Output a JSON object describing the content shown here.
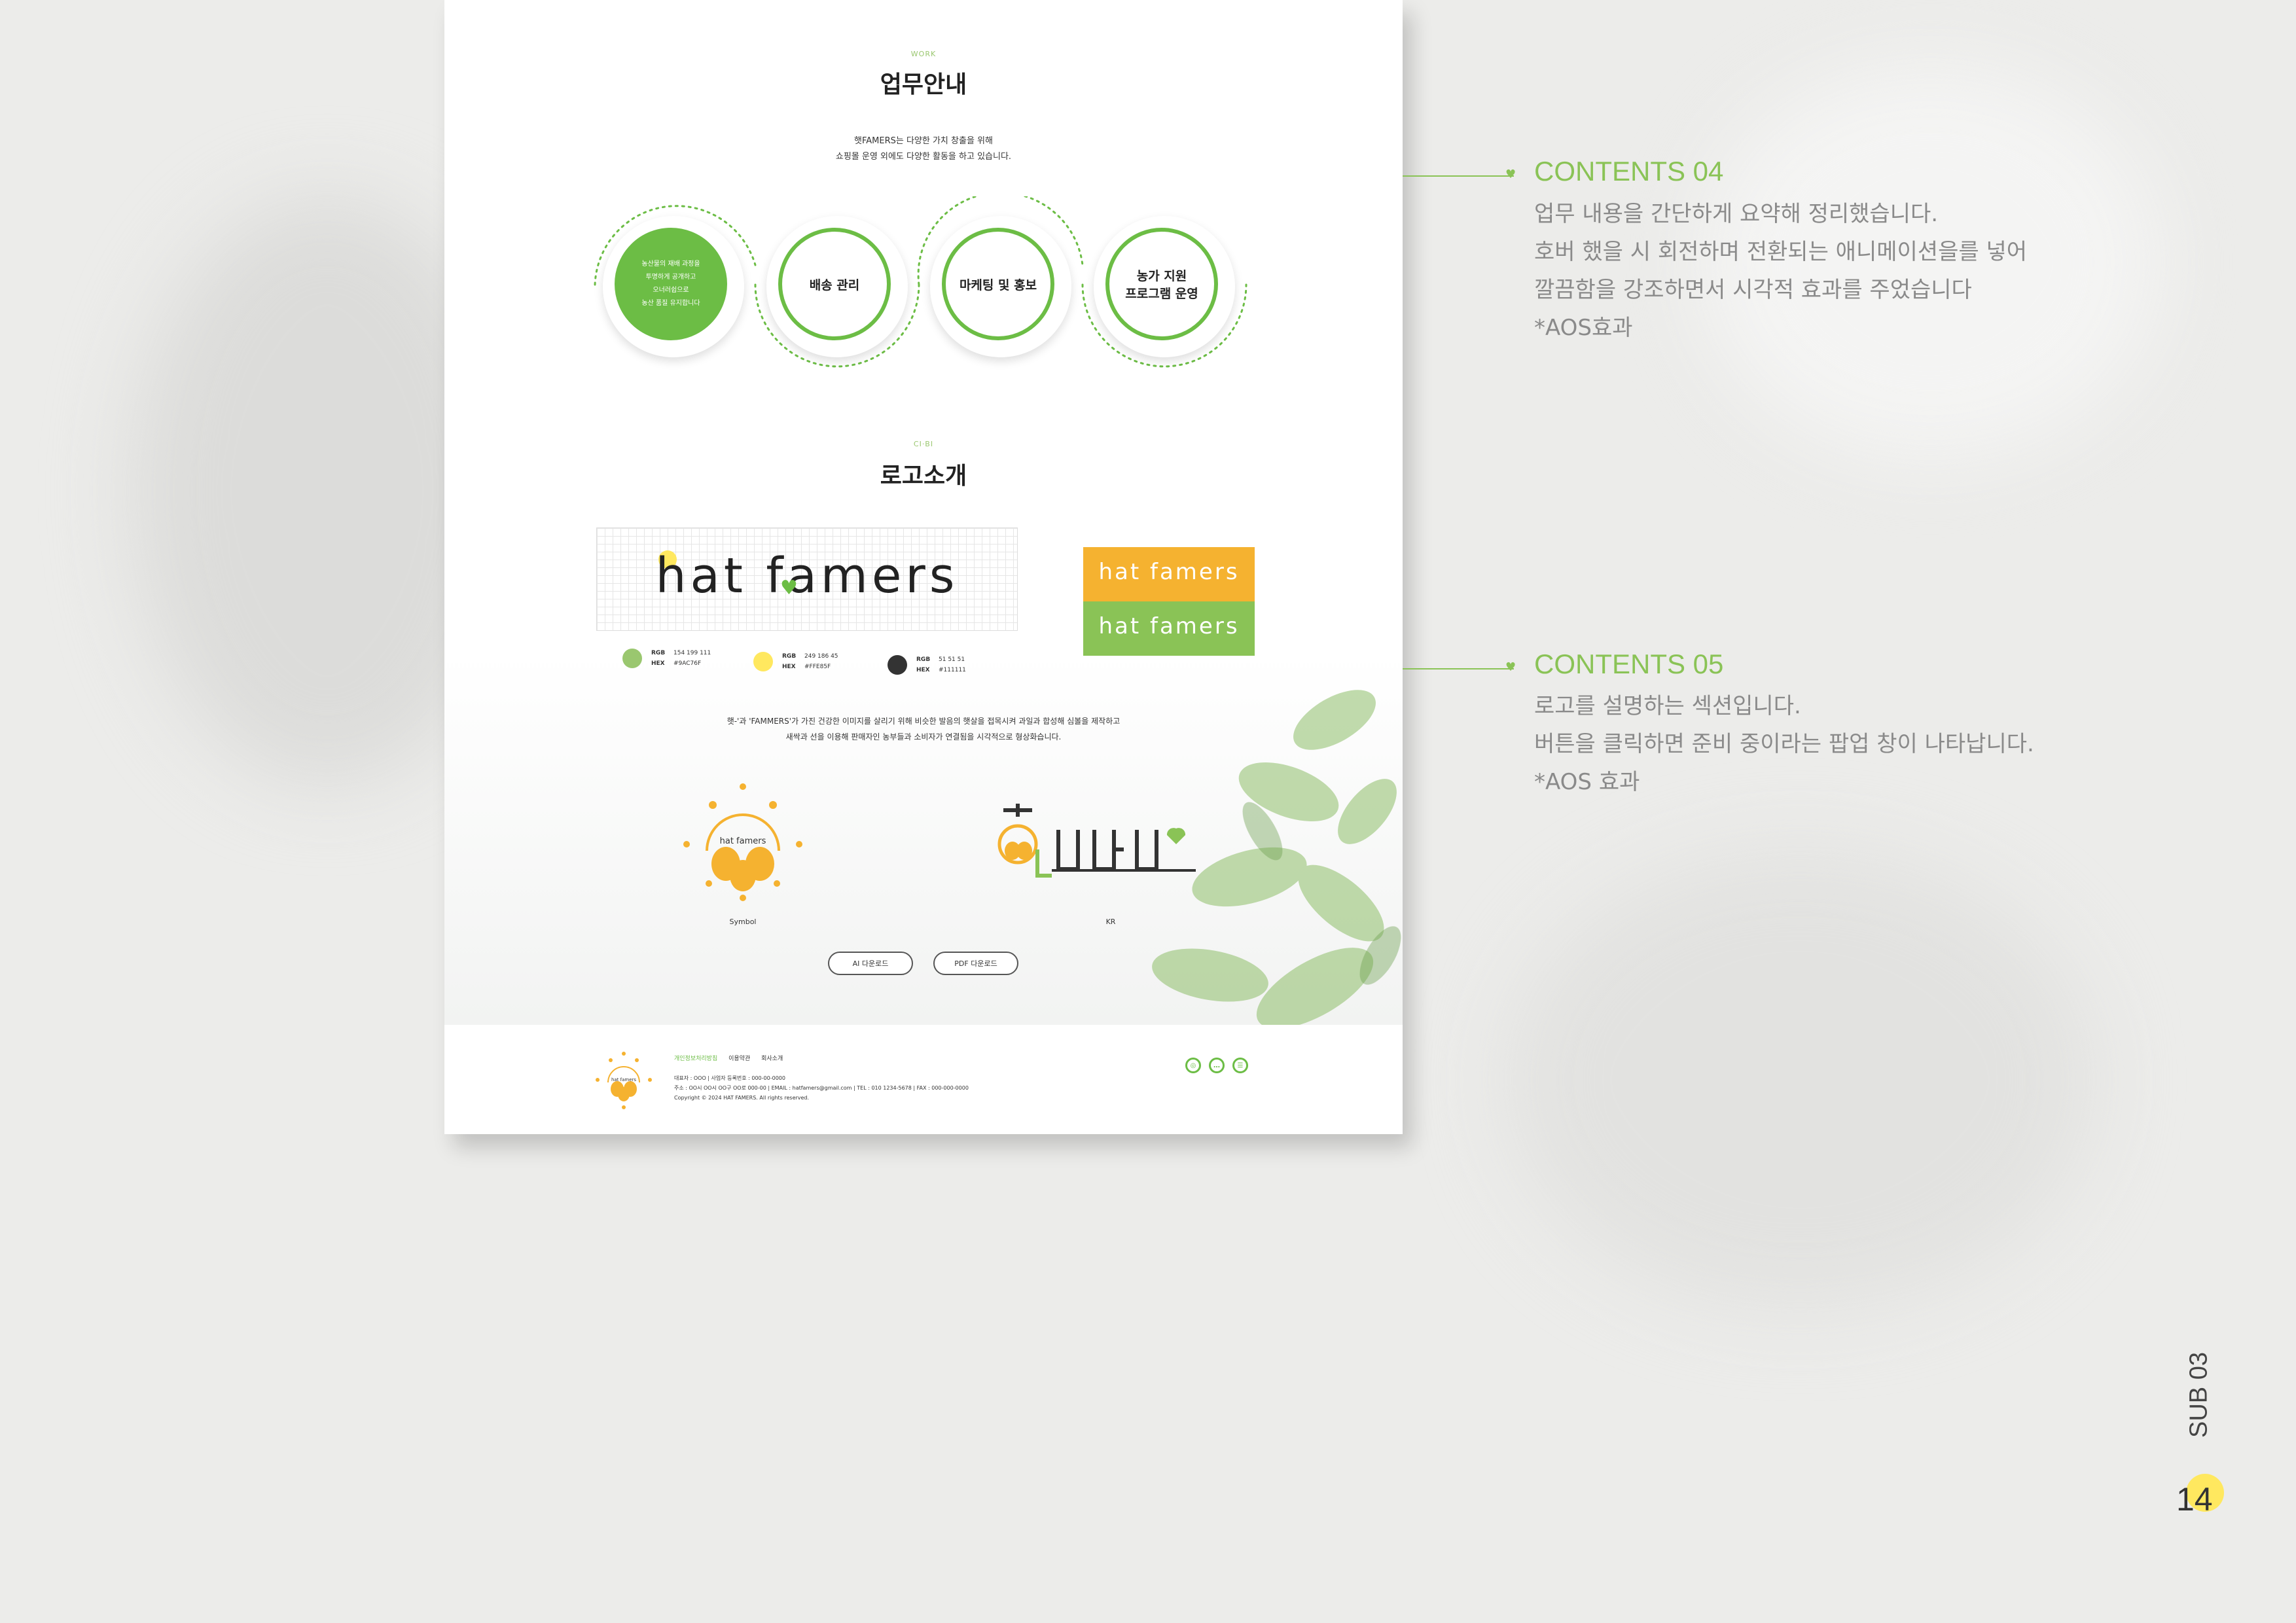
{
  "colors": {
    "accent": "#6cbd45",
    "accent_light": "#9ac76f",
    "yellow": "#ffe85f",
    "orange": "#f5b230",
    "dark": "#111111"
  },
  "work": {
    "en": "WORK",
    "title": "업무안내",
    "desc_line1": "햇FAMERS는 다양한 가치 창출을 위해",
    "desc_line2": "쇼핑몰 운영 외에도 다양한 활동을 하고 있습니다.",
    "circles": [
      {
        "lines": [
          "농산물의 재배 과정을",
          "투명하게 공개하고",
          "오너러쉽으로",
          "농산 품질 유지합니다"
        ]
      },
      {
        "lines": [
          "배송 관리"
        ]
      },
      {
        "lines": [
          "마케팅 및 홍보"
        ]
      },
      {
        "lines": [
          "농가 지원",
          "프로그램 운영"
        ]
      }
    ]
  },
  "ci": {
    "en": "CI·BI",
    "title": "로고소개",
    "logo_text": "hat famers",
    "swatches": [
      {
        "rgb_label": "RGB",
        "rgb": "154   199   111",
        "hex_label": "HEX",
        "hex": "#9AC76F",
        "color": "#9ac76f"
      },
      {
        "rgb_label": "RGB",
        "rgb": "249   186   45",
        "hex_label": "HEX",
        "hex": "#FFE85F",
        "color": "#ffe85f"
      },
      {
        "rgb_label": "RGB",
        "rgb": "51   51   51",
        "hex_label": "HEX",
        "hex": "#111111",
        "color": "#333333"
      }
    ],
    "desc_line1": "햇-'과 'FAMMERS'가 가진 건강한 이미지를 살리기 위해 비슷한 발음의 햇살을 접목시켜 과일과 합성해 심볼을 제작하고",
    "desc_line2": "새싹과 선을 이용해 판매자인 농부들과 소비자가 연결됨을 시각적으로 형상화습니다.",
    "symbol_caption": "Symbol",
    "symbol_text": "hat famers",
    "kr_caption": "KR",
    "btn_ai": "AI 다운로드",
    "btn_pdf": "PDF 다운로드"
  },
  "footer": {
    "links": [
      "개인정보처리방침",
      "이용약관",
      "회사소개"
    ],
    "line1": "대표자 : OOO  |  사업자 등록번호 : 000-00-0000",
    "line2": "주소 : OO시 OO시 OO구 OO로 000-00  |  EMAIL : hatfamers@gmail.com  |  TEL : 010 1234-5678  |  FAX : 000-000-0000",
    "line3": "Copyright © 2024 HAT FAMERS. All rights reserved.",
    "logo_text": "hat famers",
    "social_icons": [
      "instagram-icon",
      "chat-icon",
      "talk-icon"
    ]
  },
  "annotations": [
    {
      "title": "CONTENTS 04",
      "lines": [
        "업무 내용을 간단하게 요약해 정리했습니다.",
        "호버 했을 시 회전하며 전환되는 애니메이션을를 넣어",
        "깔끔함을 강조하면서 시각적 효과를 주었습니다",
        "*AOS효과"
      ]
    },
    {
      "title": "CONTENTS 05",
      "lines": [
        "로고를 설명하는 섹션입니다.",
        "버튼을 클릭하면 준비 중이라는 팝업 창이 나타납니다.",
        "*AOS 효과"
      ]
    }
  ],
  "page_label": "SUB 03",
  "page_number": "14"
}
